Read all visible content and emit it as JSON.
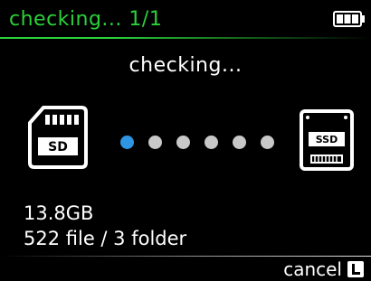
{
  "header": {
    "title": "checking... 1/1",
    "accent_color": "#2bd13a",
    "battery_icon": "battery-full-icon"
  },
  "main": {
    "status": "checking...",
    "source_icon": "sd-card-icon",
    "source_icon_label": "SD",
    "target_icon": "ssd-icon",
    "target_icon_label": "SSD",
    "progress": {
      "total_dots": 6,
      "active_dot": 1,
      "active_color": "#2f95e3"
    },
    "size": "13.8GB",
    "files": "522 file / 3 folder"
  },
  "footer": {
    "cancel_label": "cancel",
    "cancel_key": "L"
  }
}
